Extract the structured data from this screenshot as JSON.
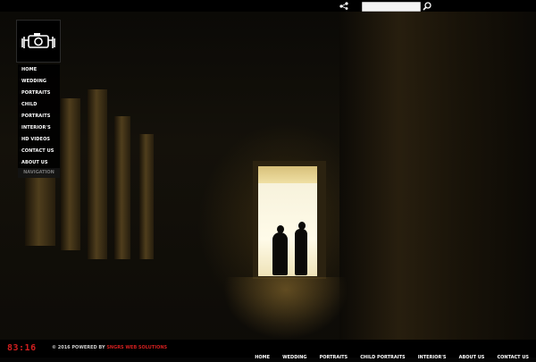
{
  "search": {
    "placeholder": "",
    "value": ""
  },
  "sidebar": {
    "items": [
      {
        "label": "HOME"
      },
      {
        "label": "WEDDING"
      },
      {
        "label": "PORTRAITS"
      },
      {
        "label": "CHILD"
      },
      {
        "label": "PORTRAITS"
      },
      {
        "label": "INTERIOR'S"
      },
      {
        "label": "HD VIDEOS"
      },
      {
        "label": "CONTACT US"
      },
      {
        "label": "ABOUT US"
      }
    ],
    "nav_label": "NAVIGATION"
  },
  "footer": {
    "clock": "83:16",
    "copyright_prefix": "© 2016 POWERED BY ",
    "copyright_brand": "SNGRS WEB SOLUTIONS",
    "links": [
      {
        "label": "HOME"
      },
      {
        "label": "WEDDING"
      },
      {
        "label": "PORTRAITS"
      },
      {
        "label": "CHILD PORTRAITS"
      },
      {
        "label": "INTERIOR'S"
      },
      {
        "label": "ABOUT US"
      },
      {
        "label": "CONTACT US"
      }
    ]
  },
  "icons": {
    "logo": "camera-hands-icon",
    "share": "share-icon",
    "search": "search-icon"
  },
  "colors": {
    "accent_red": "#d11f1f",
    "bar_black": "#000000",
    "text_white": "#ffffff"
  }
}
